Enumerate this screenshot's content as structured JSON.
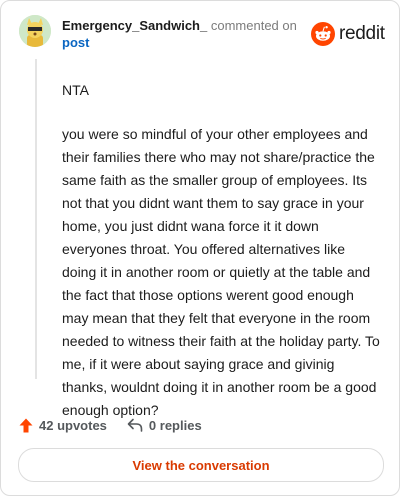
{
  "comment": {
    "username": "Emergency_Sandwich_",
    "meta": "commented on",
    "post_link": "post",
    "verdict": "NTA",
    "body": "you were so mindful of your other employees and their families there who may not share/practice the same faith as the smaller group of employees. Its not that you didnt want them to say grace in your home, you just didnt wana force it it down everyones throat. You offered alternatives like doing it in another room or quietly at the table and the fact that those options werent good enough may mean that they felt that everyone in the room needed to witness their faith at the holiday party. To me, if it were about saying grace and givinig thanks, wouldnt doing it in another room be a good enough option?"
  },
  "brand": {
    "logo_text": "reddit",
    "color": "#ff4500"
  },
  "actions": {
    "upvotes": "42 upvotes",
    "replies": "0 replies",
    "upvote_icon": "upvote-arrow-icon",
    "reply_icon": "reply-arrow-icon"
  },
  "footer": {
    "view_label": "View the conversation"
  }
}
